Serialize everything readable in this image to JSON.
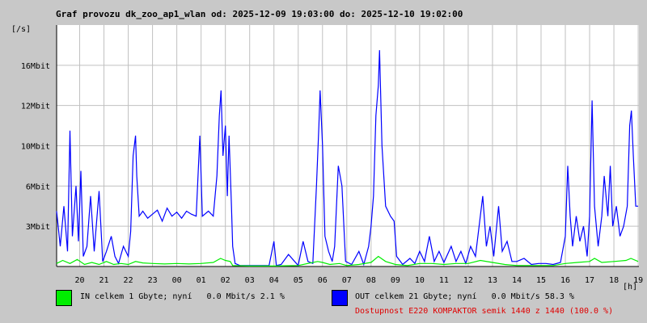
{
  "title": "Graf provozu dk_zoo_ap1_wlan od: 2025-12-09 19:03:00 do: 2025-12-10 19:02:00",
  "legend": {
    "in_text": "IN celkem 1 Gbyte; nyní   0.0 Mbit/s 2.1 %",
    "out_text": "OUT celkem 21 Gbyte; nyní   0.0 Mbit/s 58.3 %",
    "availability": "Dostupnost E220 KOMPAKTOR semik 1440 z 1440 (100.0 %)"
  },
  "colors": {
    "in": "#00ee00",
    "out": "#0000ff",
    "grid": "#c0c0c0",
    "plot_bg": "#ffffff",
    "availability": "#e00000"
  },
  "chart_data": {
    "type": "line",
    "title": "Graf provozu dk_zoo_ap1_wlan od: 2025-12-09 19:03:00 do: 2025-12-10 19:02:00",
    "xlabel": "[h]",
    "ylabel": "[/s]",
    "xlim": [
      19.05,
      43.03
    ],
    "ylim": [
      0,
      24
    ],
    "x_ticks": [
      {
        "v": 20,
        "label": "20"
      },
      {
        "v": 21,
        "label": "21"
      },
      {
        "v": 22,
        "label": "22"
      },
      {
        "v": 23,
        "label": "23"
      },
      {
        "v": 24,
        "label": "00"
      },
      {
        "v": 25,
        "label": "01"
      },
      {
        "v": 26,
        "label": "02"
      },
      {
        "v": 27,
        "label": "03"
      },
      {
        "v": 28,
        "label": "04"
      },
      {
        "v": 29,
        "label": "05"
      },
      {
        "v": 30,
        "label": "06"
      },
      {
        "v": 31,
        "label": "07"
      },
      {
        "v": 32,
        "label": "08"
      },
      {
        "v": 33,
        "label": "09"
      },
      {
        "v": 34,
        "label": "10"
      },
      {
        "v": 35,
        "label": "11"
      },
      {
        "v": 36,
        "label": "12"
      },
      {
        "v": 37,
        "label": "13"
      },
      {
        "v": 38,
        "label": "14"
      },
      {
        "v": 39,
        "label": "15"
      },
      {
        "v": 40,
        "label": "16"
      },
      {
        "v": 41,
        "label": "17"
      },
      {
        "v": 42,
        "label": "18"
      },
      {
        "v": 43,
        "label": "19"
      }
    ],
    "y_ticks": [
      {
        "v": 4,
        "label": "3Mbit"
      },
      {
        "v": 8,
        "label": "6Mbit"
      },
      {
        "v": 12,
        "label": "10Mbit"
      },
      {
        "v": 16,
        "label": "12Mbit"
      },
      {
        "v": 20,
        "label": "16Mbit"
      }
    ],
    "series": [
      {
        "color": "#0000ff",
        "points": [
          [
            19.05,
            5.5
          ],
          [
            19.2,
            2
          ],
          [
            19.35,
            6
          ],
          [
            19.5,
            1.5
          ],
          [
            19.6,
            13.5
          ],
          [
            19.7,
            3
          ],
          [
            19.85,
            8
          ],
          [
            19.95,
            2.5
          ],
          [
            20.05,
            9.5
          ],
          [
            20.15,
            1
          ],
          [
            20.3,
            2
          ],
          [
            20.45,
            7
          ],
          [
            20.6,
            1.5
          ],
          [
            20.8,
            7.5
          ],
          [
            20.95,
            0.5
          ],
          [
            21.1,
            1.5
          ],
          [
            21.3,
            3
          ],
          [
            21.45,
            1
          ],
          [
            21.6,
            0.3
          ],
          [
            21.8,
            2
          ],
          [
            22.0,
            1
          ],
          [
            22.1,
            3.5
          ],
          [
            22.2,
            11
          ],
          [
            22.3,
            13
          ],
          [
            22.35,
            9
          ],
          [
            22.45,
            5
          ],
          [
            22.6,
            5.5
          ],
          [
            22.8,
            4.8
          ],
          [
            23.0,
            5.2
          ],
          [
            23.2,
            5.6
          ],
          [
            23.4,
            4.5
          ],
          [
            23.6,
            5.8
          ],
          [
            23.8,
            5.0
          ],
          [
            24.0,
            5.4
          ],
          [
            24.2,
            4.8
          ],
          [
            24.4,
            5.5
          ],
          [
            24.6,
            5.2
          ],
          [
            24.8,
            5.0
          ],
          [
            24.95,
            13
          ],
          [
            25.05,
            5
          ],
          [
            25.3,
            5.5
          ],
          [
            25.5,
            5
          ],
          [
            25.65,
            9
          ],
          [
            25.75,
            15
          ],
          [
            25.82,
            17.5
          ],
          [
            25.9,
            11
          ],
          [
            26.0,
            14
          ],
          [
            26.08,
            7
          ],
          [
            26.15,
            13
          ],
          [
            26.25,
            6
          ],
          [
            26.3,
            2
          ],
          [
            26.4,
            0.3
          ],
          [
            26.6,
            0.1
          ],
          [
            27.0,
            0.1
          ],
          [
            27.4,
            0.1
          ],
          [
            27.8,
            0.1
          ],
          [
            28.0,
            2.5
          ],
          [
            28.1,
            0.1
          ],
          [
            28.3,
            0.2
          ],
          [
            28.6,
            1.2
          ],
          [
            29.0,
            0.1
          ],
          [
            29.2,
            2.5
          ],
          [
            29.4,
            0.5
          ],
          [
            29.6,
            0.3
          ],
          [
            29.75,
            8
          ],
          [
            29.85,
            14
          ],
          [
            29.9,
            17.5
          ],
          [
            30.0,
            12
          ],
          [
            30.1,
            3
          ],
          [
            30.25,
            1.5
          ],
          [
            30.4,
            0.5
          ],
          [
            30.5,
            2
          ],
          [
            30.65,
            10
          ],
          [
            30.8,
            8
          ],
          [
            30.95,
            0.5
          ],
          [
            31.2,
            0.2
          ],
          [
            31.5,
            1.5
          ],
          [
            31.7,
            0.2
          ],
          [
            31.9,
            2
          ],
          [
            32.0,
            4
          ],
          [
            32.1,
            7
          ],
          [
            32.2,
            15
          ],
          [
            32.3,
            18
          ],
          [
            32.35,
            21.5
          ],
          [
            32.45,
            12
          ],
          [
            32.6,
            6
          ],
          [
            32.8,
            5
          ],
          [
            32.95,
            4.5
          ],
          [
            33.05,
            1
          ],
          [
            33.3,
            0.2
          ],
          [
            33.6,
            0.8
          ],
          [
            33.8,
            0.3
          ],
          [
            34.0,
            1.5
          ],
          [
            34.2,
            0.5
          ],
          [
            34.4,
            3
          ],
          [
            34.6,
            0.5
          ],
          [
            34.8,
            1.5
          ],
          [
            35.0,
            0.4
          ],
          [
            35.3,
            2
          ],
          [
            35.5,
            0.5
          ],
          [
            35.7,
            1.5
          ],
          [
            35.9,
            0.3
          ],
          [
            36.1,
            2
          ],
          [
            36.3,
            1
          ],
          [
            36.5,
            5
          ],
          [
            36.6,
            7
          ],
          [
            36.75,
            2
          ],
          [
            36.9,
            4
          ],
          [
            37.05,
            1
          ],
          [
            37.25,
            6
          ],
          [
            37.4,
            1.5
          ],
          [
            37.6,
            2.5
          ],
          [
            37.8,
            0.5
          ],
          [
            38.0,
            0.5
          ],
          [
            38.3,
            0.8
          ],
          [
            38.6,
            0.2
          ],
          [
            38.9,
            0.3
          ],
          [
            39.2,
            0.3
          ],
          [
            39.5,
            0.2
          ],
          [
            39.8,
            0.4
          ],
          [
            40.0,
            3
          ],
          [
            40.1,
            10
          ],
          [
            40.2,
            5
          ],
          [
            40.3,
            2
          ],
          [
            40.45,
            5
          ],
          [
            40.6,
            2.5
          ],
          [
            40.75,
            4
          ],
          [
            40.9,
            1
          ],
          [
            41.0,
            5
          ],
          [
            41.1,
            16.5
          ],
          [
            41.2,
            6
          ],
          [
            41.35,
            2
          ],
          [
            41.5,
            5
          ],
          [
            41.6,
            9
          ],
          [
            41.75,
            5
          ],
          [
            41.85,
            10
          ],
          [
            41.95,
            4
          ],
          [
            42.1,
            6
          ],
          [
            42.25,
            3
          ],
          [
            42.4,
            4
          ],
          [
            42.55,
            6
          ],
          [
            42.65,
            14
          ],
          [
            42.72,
            15.5
          ],
          [
            42.8,
            11
          ],
          [
            42.9,
            6
          ],
          [
            43.0,
            6
          ]
        ]
      },
      {
        "color": "#00ee00",
        "points": [
          [
            19.05,
            0.3
          ],
          [
            19.3,
            0.6
          ],
          [
            19.6,
            0.3
          ],
          [
            19.9,
            0.7
          ],
          [
            20.2,
            0.2
          ],
          [
            20.5,
            0.4
          ],
          [
            20.8,
            0.2
          ],
          [
            21.1,
            0.5
          ],
          [
            21.4,
            0.2
          ],
          [
            21.7,
            0.3
          ],
          [
            22.0,
            0.2
          ],
          [
            22.3,
            0.5
          ],
          [
            22.6,
            0.35
          ],
          [
            23.0,
            0.3
          ],
          [
            23.5,
            0.25
          ],
          [
            24.0,
            0.3
          ],
          [
            24.5,
            0.25
          ],
          [
            25.0,
            0.3
          ],
          [
            25.5,
            0.4
          ],
          [
            25.8,
            0.8
          ],
          [
            26.0,
            0.6
          ],
          [
            26.2,
            0.5
          ],
          [
            26.3,
            0.1
          ],
          [
            27.0,
            0.05
          ],
          [
            28.0,
            0.05
          ],
          [
            29.0,
            0.1
          ],
          [
            29.8,
            0.5
          ],
          [
            30.0,
            0.4
          ],
          [
            30.3,
            0.2
          ],
          [
            30.7,
            0.3
          ],
          [
            31.0,
            0.1
          ],
          [
            31.5,
            0.2
          ],
          [
            32.0,
            0.4
          ],
          [
            32.3,
            1.0
          ],
          [
            32.6,
            0.5
          ],
          [
            33.0,
            0.2
          ],
          [
            33.5,
            0.1
          ],
          [
            34.0,
            0.3
          ],
          [
            34.5,
            0.3
          ],
          [
            35.0,
            0.2
          ],
          [
            35.5,
            0.3
          ],
          [
            36.0,
            0.3
          ],
          [
            36.5,
            0.6
          ],
          [
            37.0,
            0.4
          ],
          [
            37.5,
            0.2
          ],
          [
            38.0,
            0.1
          ],
          [
            38.5,
            0.1
          ],
          [
            39.0,
            0.1
          ],
          [
            39.5,
            0.1
          ],
          [
            40.0,
            0.3
          ],
          [
            40.5,
            0.4
          ],
          [
            41.0,
            0.5
          ],
          [
            41.2,
            0.8
          ],
          [
            41.5,
            0.4
          ],
          [
            42.0,
            0.5
          ],
          [
            42.5,
            0.6
          ],
          [
            42.7,
            0.8
          ],
          [
            43.0,
            0.5
          ]
        ]
      }
    ]
  }
}
